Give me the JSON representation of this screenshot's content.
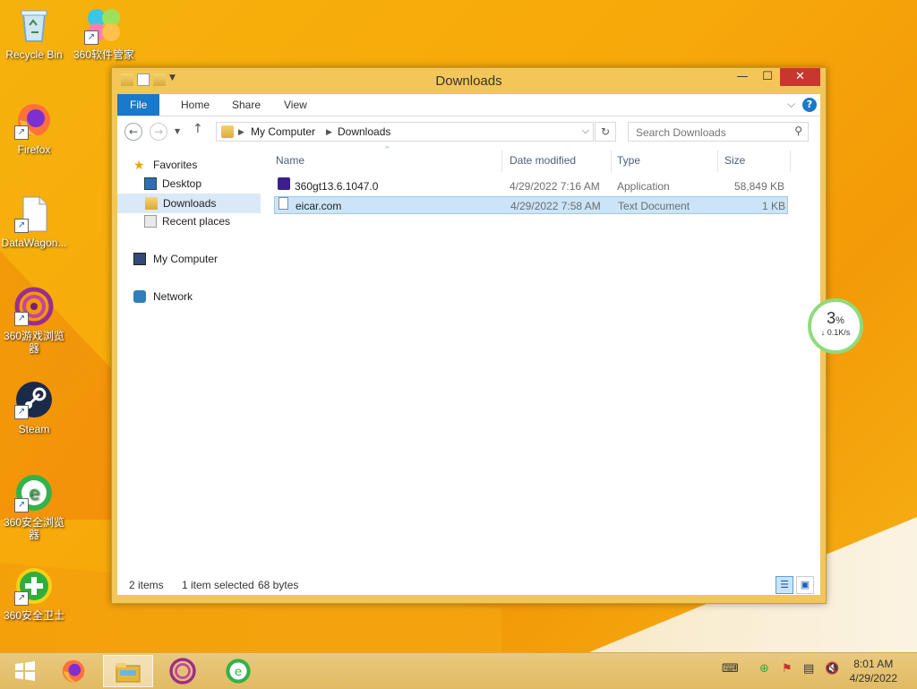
{
  "desktop": {
    "icons": [
      {
        "label": "Recycle Bin"
      },
      {
        "label": "360软件管家"
      },
      {
        "label": "Firefox"
      },
      {
        "label": "DataWagon..."
      },
      {
        "label": "360游戏浏览器"
      },
      {
        "label": "Steam"
      },
      {
        "label": "360安全浏览器"
      },
      {
        "label": "360安全卫士"
      }
    ]
  },
  "window": {
    "title": "Downloads",
    "controls": {
      "minimize": "—",
      "maximize": "☐",
      "close": "✕"
    },
    "ribbon": {
      "tabs": [
        "File",
        "Home",
        "Share",
        "View"
      ]
    },
    "address": {
      "segments": [
        "My Computer",
        "Downloads"
      ]
    },
    "search": {
      "placeholder": "Search Downloads"
    },
    "nav": {
      "favorites": "Favorites",
      "desktop": "Desktop",
      "downloads": "Downloads",
      "recent": "Recent places",
      "computer": "My Computer",
      "network": "Network"
    },
    "columns": [
      "Name",
      "Date modified",
      "Type",
      "Size"
    ],
    "files": [
      {
        "name": "360gt13.6.1047.0",
        "date": "4/29/2022 7:16 AM",
        "type": "Application",
        "size": "58,849 KB"
      },
      {
        "name": "eicar.com",
        "date": "4/29/2022 7:58 AM",
        "type": "Text Document",
        "size": "1 KB"
      }
    ],
    "status": {
      "count": "2 items",
      "selected": "1 item selected",
      "bytes": "68 bytes"
    }
  },
  "speed_widget": {
    "percent": "3",
    "unit": "%",
    "rate": "↓ 0.1K/s"
  },
  "taskbar": {
    "time": "8:01 AM",
    "date": "4/29/2022"
  }
}
